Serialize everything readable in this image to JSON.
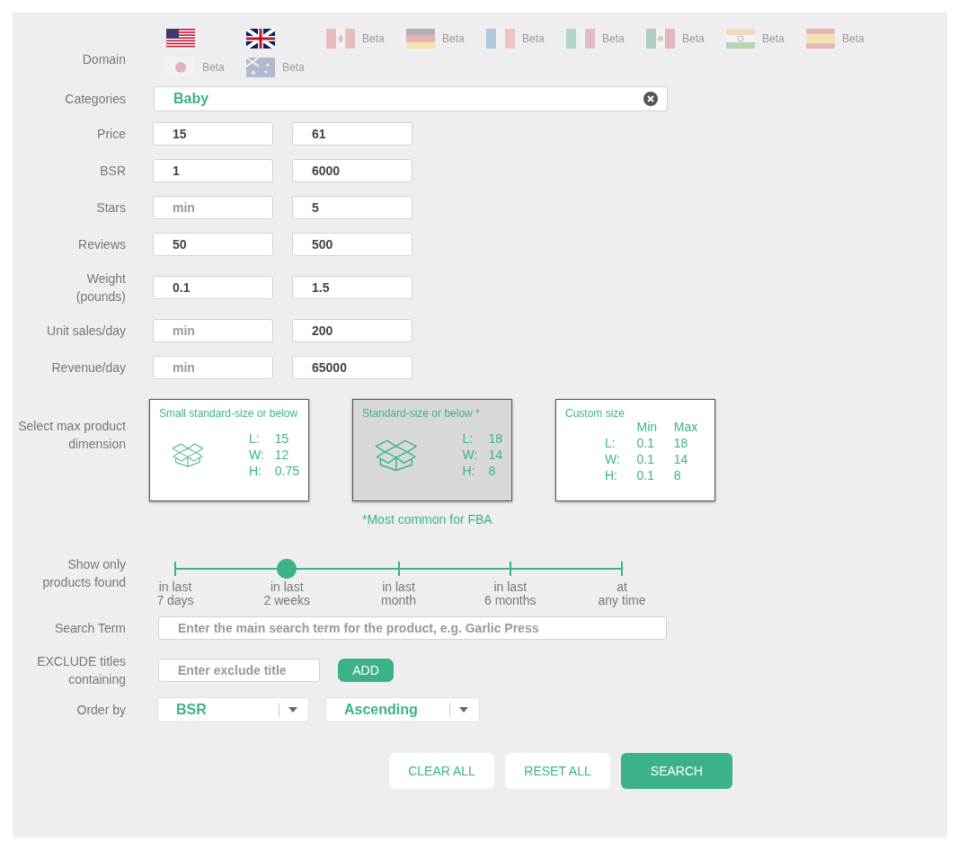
{
  "domain": {
    "label": "Domain",
    "flags": [
      {
        "kind": "us",
        "disabled": false
      },
      {
        "kind": "uk",
        "disabled": false
      },
      {
        "kind": "ca",
        "disabled": true,
        "badge": "Beta"
      },
      {
        "kind": "de",
        "disabled": true,
        "badge": "Beta"
      },
      {
        "kind": "fr",
        "disabled": true,
        "badge": "Beta"
      },
      {
        "kind": "it",
        "disabled": true,
        "badge": "Beta"
      },
      {
        "kind": "mx",
        "disabled": true,
        "badge": "Beta"
      },
      {
        "kind": "in",
        "disabled": true,
        "badge": "Beta"
      },
      {
        "kind": "es",
        "disabled": true,
        "badge": "Beta"
      },
      {
        "kind": "jp",
        "disabled": true,
        "badge": "Beta"
      },
      {
        "kind": "au",
        "disabled": true,
        "badge": "Beta"
      }
    ]
  },
  "categories": {
    "label": "Categories",
    "value": "Baby"
  },
  "ranges": [
    {
      "label": "Price",
      "min": {
        "value": "15"
      },
      "max": {
        "value": "61"
      }
    },
    {
      "label": "BSR",
      "min": {
        "value": "1"
      },
      "max": {
        "value": "6000"
      }
    },
    {
      "label": "Stars",
      "min": {
        "placeholder": "min"
      },
      "max": {
        "value": "5"
      }
    },
    {
      "label": "Reviews",
      "min": {
        "value": "50"
      },
      "max": {
        "value": "500"
      }
    },
    {
      "label": "Weight\n(pounds)",
      "min": {
        "value": "0.1"
      },
      "max": {
        "value": "1.5"
      }
    },
    {
      "label": "Unit sales/day",
      "min": {
        "placeholder": "min"
      },
      "max": {
        "value": "200"
      }
    },
    {
      "label": "Revenue/day",
      "min": {
        "placeholder": "min"
      },
      "max": {
        "value": "65000"
      }
    }
  ],
  "dimension": {
    "label": "Select max product\ndimension",
    "note": "*Most common for FBA",
    "cards": [
      {
        "kind": "preset",
        "title": "Small standard-size or below",
        "selected": false,
        "rows": [
          [
            "L:",
            "15"
          ],
          [
            "W:",
            "12"
          ],
          [
            "H:",
            "0.75"
          ]
        ]
      },
      {
        "kind": "preset",
        "title": "Standard-size or below *",
        "selected": true,
        "rows": [
          [
            "L:",
            "18"
          ],
          [
            "W:",
            "14"
          ],
          [
            "H:",
            "8"
          ]
        ]
      },
      {
        "kind": "custom",
        "title": "Custom size",
        "selected": false,
        "headers": [
          "Min",
          "Max"
        ],
        "rows": [
          [
            "L:",
            "0.1",
            "18"
          ],
          [
            "W:",
            "0.1",
            "14"
          ],
          [
            "H:",
            "0.1",
            "8"
          ]
        ]
      }
    ]
  },
  "found": {
    "label": "Show only\nproducts found",
    "stops": [
      {
        "label": "in last\n7 days",
        "selected": false
      },
      {
        "label": "in last\n2 weeks",
        "selected": true
      },
      {
        "label": "in last\nmonth",
        "selected": false
      },
      {
        "label": "in last\n6 months",
        "selected": false
      },
      {
        "label": "at\nany time",
        "selected": false
      }
    ]
  },
  "search_term": {
    "label": "Search Term",
    "placeholder": "Enter the main search term for the product, e.g. Garlic Press"
  },
  "exclude": {
    "label": "EXCLUDE titles\ncontaining",
    "placeholder": "Enter exclude title",
    "button": "ADD"
  },
  "order": {
    "label": "Order by",
    "selects": [
      "BSR",
      "Ascending"
    ]
  },
  "buttons": [
    {
      "label": "CLEAR ALL",
      "kind": "secondary"
    },
    {
      "label": "RESET ALL",
      "kind": "secondary"
    },
    {
      "label": "SEARCH",
      "kind": "primary"
    }
  ]
}
